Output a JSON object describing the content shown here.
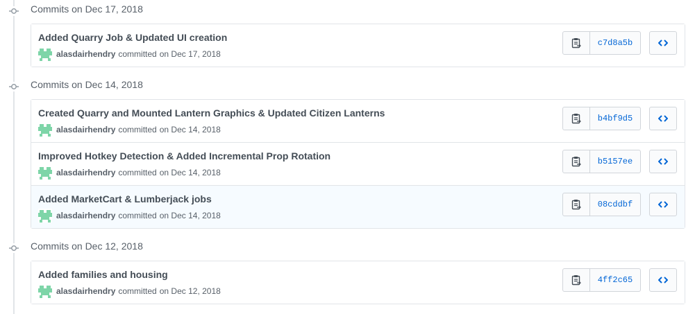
{
  "colors": {
    "accent": "#0366d6",
    "border": "#e1e4e8",
    "highlight_row": "#f6fbff",
    "avatar": "#7ed5a8"
  },
  "groups": [
    {
      "title": "Commits on Dec 17, 2018",
      "commits": [
        {
          "title": "Added Quarry Job & Updated UI creation",
          "author": "alasdairhendry",
          "committed_label": "committed",
          "date": "on Dec 17, 2018",
          "sha": "c7d8a5b",
          "copy_icon": "clippy-icon",
          "browse_icon": "code-icon"
        }
      ]
    },
    {
      "title": "Commits on Dec 14, 2018",
      "commits": [
        {
          "title": "Created Quarry and Mounted Lantern Graphics & Updated Citizen Lanterns",
          "author": "alasdairhendry",
          "committed_label": "committed",
          "date": "on Dec 14, 2018",
          "sha": "b4bf9d5",
          "copy_icon": "clippy-icon",
          "browse_icon": "code-icon"
        },
        {
          "title": "Improved Hotkey Detection & Added Incremental Prop Rotation",
          "author": "alasdairhendry",
          "committed_label": "committed",
          "date": "on Dec 14, 2018",
          "sha": "b5157ee",
          "copy_icon": "clippy-icon",
          "browse_icon": "code-icon"
        },
        {
          "title": "Added MarketCart & Lumberjack jobs",
          "author": "alasdairhendry",
          "committed_label": "committed",
          "date": "on Dec 14, 2018",
          "sha": "08cddbf",
          "copy_icon": "clippy-icon",
          "browse_icon": "code-icon"
        }
      ]
    },
    {
      "title": "Commits on Dec 12, 2018",
      "commits": [
        {
          "title": "Added families and housing",
          "author": "alasdairhendry",
          "committed_label": "committed",
          "date": "on Dec 12, 2018",
          "sha": "4ff2c65",
          "copy_icon": "clippy-icon",
          "browse_icon": "code-icon"
        }
      ]
    }
  ]
}
